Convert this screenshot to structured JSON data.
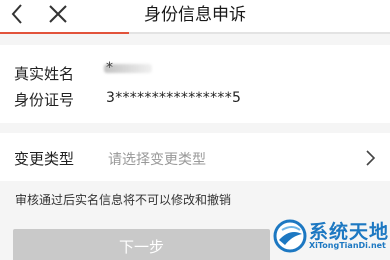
{
  "header": {
    "title": "身份信息申诉",
    "back_icon": "chevron-left-icon",
    "close_icon": "close-icon",
    "progress_fraction": 0.33,
    "accent_color": "#e2533b"
  },
  "info": {
    "name_label": "真实姓名",
    "name_value": "*",
    "id_label": "身份证号",
    "id_value": "3****************5"
  },
  "change_type": {
    "label": "变更类型",
    "placeholder": "请选择变更类型",
    "arrow_icon": "chevron-right-icon"
  },
  "notice": "审核通过后实名信息将不可以修改和撤销",
  "next_button": {
    "label": "下一步",
    "color": "#c9c9c9"
  },
  "watermark": {
    "logo_text": "系统天地",
    "url_text": "XiTongTianDi.net"
  }
}
